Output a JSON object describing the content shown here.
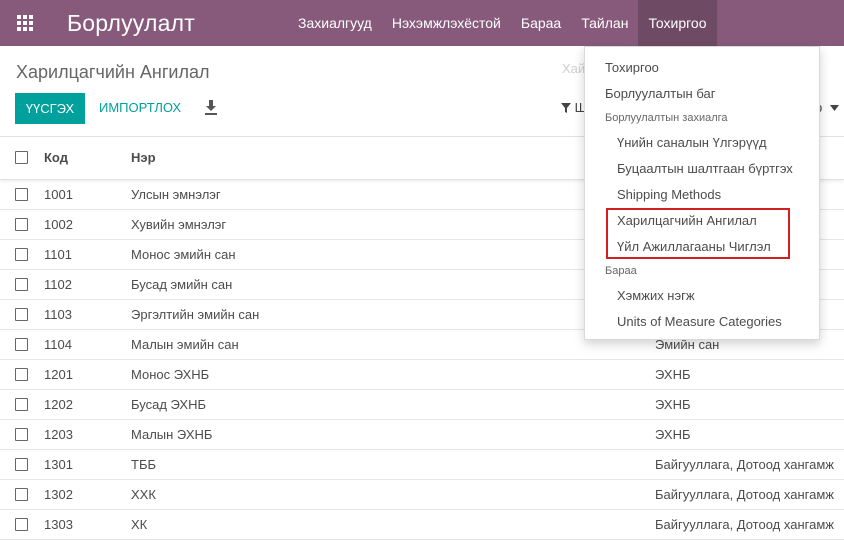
{
  "topbar": {
    "brand": "Борлуулалт",
    "menu": [
      "Захиалгууд",
      "Нэхэмжлэхёстой",
      "Бараа",
      "Тайлан",
      "Тохиргоо"
    ]
  },
  "control_panel": {
    "title": "Харилцагчийн Ангилал",
    "search_placeholder": "Хай",
    "create_label": "ҮҮСГЭХ",
    "import_label": "ИМПОРТЛОХ",
    "filter_label": "Ш",
    "favorites_tail": "р"
  },
  "table": {
    "headers": {
      "code": "Код",
      "name": "Нэр"
    },
    "rows": [
      {
        "code": "1001",
        "name": "Улсын эмнэлэг",
        "group": ""
      },
      {
        "code": "1002",
        "name": "Хувийн эмнэлэг",
        "group": ""
      },
      {
        "code": "1101",
        "name": "Монос эмийн сан",
        "group": ""
      },
      {
        "code": "1102",
        "name": "Бусад эмийн сан",
        "group": ""
      },
      {
        "code": "1103",
        "name": "Эргэлтийн эмийн сан",
        "group": ""
      },
      {
        "code": "1104",
        "name": "Малын эмийн сан",
        "group": "Эмийн сан"
      },
      {
        "code": "1201",
        "name": "Монос ЭХНБ",
        "group": "ЭХНБ"
      },
      {
        "code": "1202",
        "name": "Бусад ЭХНБ",
        "group": "ЭХНБ"
      },
      {
        "code": "1203",
        "name": "Малын ЭХНБ",
        "group": "ЭХНБ"
      },
      {
        "code": "1301",
        "name": "ТББ",
        "group": "Байгууллага, Дотоод хангамж"
      },
      {
        "code": "1302",
        "name": "ХХК",
        "group": "Байгууллага, Дотоод хангамж"
      },
      {
        "code": "1303",
        "name": "ХК",
        "group": "Байгууллага, Дотоод хангамж"
      }
    ]
  },
  "dropdown": {
    "settings": "Тохиргоо",
    "sales_team": "Борлуулалтын баг",
    "orders_header": "Борлуулалтын захиалга",
    "pricelists": "Үнийн саналын Үлгэрүүд",
    "reasons": "Буцаалтын шалтгаан бүртгэх",
    "shipping": "Shipping Methods",
    "partner_categories": "Харилцагчийн Ангилал",
    "activity_types": "Үйл Ажиллагааны Чиглэл",
    "products_header": "Бараа",
    "uom": "Хэмжих нэгж",
    "uom_categories": "Units of Measure Categories"
  },
  "colors": {
    "brand": "#875a7b",
    "accent": "#00a09d",
    "highlight": "#d21f1f"
  }
}
